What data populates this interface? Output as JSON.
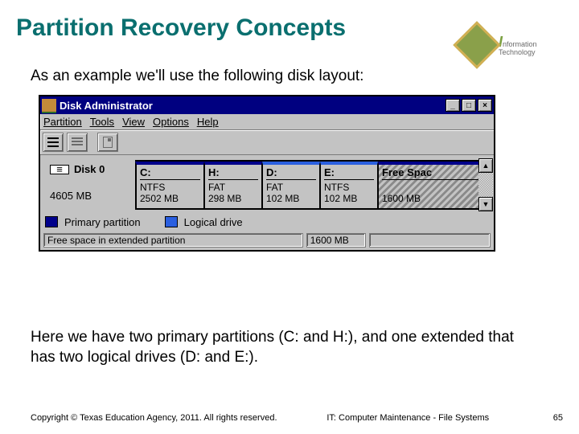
{
  "title": "Partition Recovery Concepts",
  "logo": {
    "line1": "nformation",
    "line2": "Technology"
  },
  "intro": "As an example we'll use the following disk layout:",
  "window": {
    "title": "Disk Administrator",
    "menu": [
      "Partition",
      "Tools",
      "View",
      "Options",
      "Help"
    ],
    "disk": {
      "name": "Disk 0",
      "size": "4605 MB"
    },
    "partitions": [
      {
        "letter": "C:",
        "fs": "NTFS",
        "size": "2502 MB"
      },
      {
        "letter": "H:",
        "fs": "FAT",
        "size": "298 MB"
      },
      {
        "letter": "D:",
        "fs": "FAT",
        "size": "102 MB"
      },
      {
        "letter": "E:",
        "fs": "NTFS",
        "size": "102 MB"
      }
    ],
    "free": {
      "label": "Free Spac",
      "size": "1600 MB"
    },
    "legend": {
      "primary": "Primary partition",
      "logical": "Logical drive"
    },
    "status": {
      "label": "Free space in extended partition",
      "size": "1600 MB"
    }
  },
  "outro": "Here we have two primary partitions (C: and H:), and one extended that has two logical drives (D: and E:).",
  "footer": {
    "copyright": "Copyright © Texas Education Agency, 2011. All rights reserved.",
    "course": "IT: Computer Maintenance - File Systems",
    "page": "65"
  }
}
